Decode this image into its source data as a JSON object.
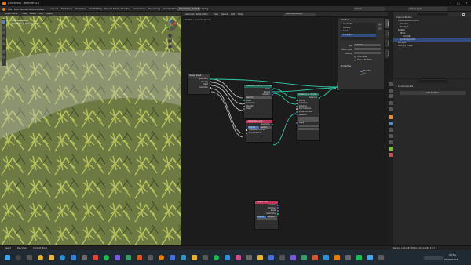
{
  "window": {
    "title": "(Unsaved) - Blender 4.1",
    "controls": [
      "–",
      "□",
      "✕"
    ]
  },
  "menu": {
    "items": [
      "File",
      "Edit",
      "Render",
      "Window",
      "Help"
    ],
    "workspaces": [
      "Layout",
      "Modeling",
      "Sculpting",
      "UV Editing",
      "Texture Paint",
      "Shading",
      "Animation",
      "Rendering",
      "Compositing",
      "Geometry Nodes",
      "Scripting"
    ],
    "active_workspace": "Geometry Nodes",
    "scene": "Scene",
    "view_layer": "ViewLayer"
  },
  "viewport": {
    "header": [
      "Object Mode",
      "View",
      "Select",
      "Add",
      "Object"
    ],
    "overlay_line1": "User Perspective",
    "overlay_line2": "(0) Scatter | Landscape.001",
    "footer": [
      "Object",
      "View",
      "Marker"
    ]
  },
  "node_editor": {
    "header": [
      "Geometry Node Editor",
      "View",
      "Select",
      "Add",
      "Node"
    ],
    "modifier_name": "GeometryNodes",
    "breadcrumb": "Scatter ▸ GeometryNodes",
    "footer_tab": "Grease Pencil",
    "nodes": {
      "group_input": {
        "title": "Group Input",
        "sockets": [
          "Geometry",
          "Density",
          "Seed",
          "Collection"
        ]
      },
      "distribute": {
        "title": "Distribute Points on Faces",
        "mode": "Random",
        "sockets": [
          "Points",
          "Normal",
          "Rotation",
          "Mesh",
          "Selection",
          "Distance Min",
          "Density",
          "Seed"
        ]
      },
      "instance": {
        "title": "Instance on Points",
        "sockets": [
          "Instances",
          "Points",
          "Selection",
          "Instance",
          "Pick Instance",
          "Instance Index",
          "Rotation",
          "Scale"
        ]
      },
      "collection_info": {
        "title": "Collection Info",
        "mode_a": "Original",
        "mode_b": "Relative",
        "sockets": [
          "Geometry",
          "Separate Children",
          "Reset Children"
        ]
      },
      "group_output": {
        "title": "Group Output",
        "sockets": [
          "Geometry"
        ]
      },
      "object_info": {
        "title": "Object Info",
        "sockets": [
          "Location",
          "Rotation",
          "Scale",
          "Geometry"
        ],
        "mode_a": "Original",
        "mode_b": "Relative"
      }
    },
    "npanel": {
      "title": "Interface",
      "items": [
        "Geometry",
        "Density",
        "Seed",
        "Collection"
      ],
      "selected": "Collection",
      "fields": [
        {
          "label": "Type",
          "value": "Collection"
        },
        {
          "label": "Description",
          "value": ""
        },
        {
          "label": "Default",
          "value": ""
        }
      ],
      "checks": [
        "Hide Value",
        "Hide in Modifier"
      ],
      "properties_title": "Properties",
      "properties": [
        "Modifier",
        "Tool"
      ],
      "side_tabs": [
        "Node",
        "Tool",
        "View",
        "Group"
      ]
    }
  },
  "outliner": {
    "title": "Scene Collection",
    "rows": [
      {
        "label": "CAMERA AND LIGHTS",
        "indent": 1,
        "selected": false
      },
      {
        "label": "Camera",
        "indent": 2,
        "selected": false
      },
      {
        "label": "Sunlight",
        "indent": 2,
        "selected": false
      },
      {
        "label": "Scatter",
        "indent": 1,
        "selected": false
      },
      {
        "label": "Plant",
        "indent": 2,
        "selected": false
      },
      {
        "label": "Fern.001",
        "indent": 3,
        "selected": false
      },
      {
        "label": "Landscape.001",
        "indent": 2,
        "selected": true
      },
      {
        "label": "Sunlight",
        "indent": 1,
        "selected": false
      },
      {
        "label": "Sun Sky Scene",
        "indent": 1,
        "selected": false
      }
    ]
  },
  "properties": {
    "object_name": "Landscape.001",
    "add_modifier": "Add Modifier"
  },
  "status_bar": {
    "left": [
      "Select",
      "Pan View",
      "Context Menu"
    ],
    "right": "Memory: 1.10 GiB | VRAM: 2.6/8.0 GiB | 4.1.1"
  },
  "taskbar": {
    "time": "23:56",
    "date": "07/04/2024"
  }
}
